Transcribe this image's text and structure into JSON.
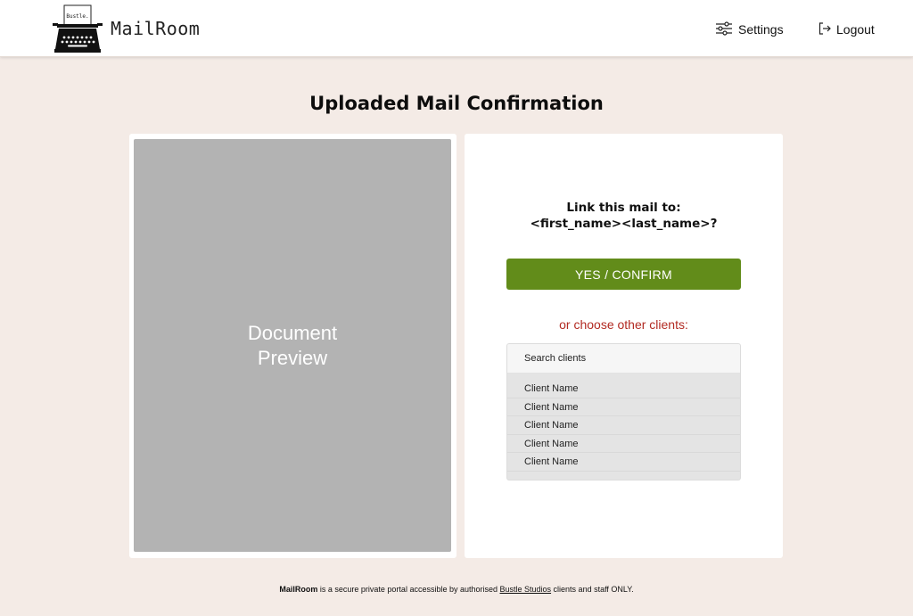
{
  "header": {
    "logo_text": "Bustle.",
    "brand": "MailRoom",
    "settings_label": "Settings",
    "logout_label": "Logout"
  },
  "page_title": "Uploaded Mail Confirmation",
  "preview": {
    "label_line1": "Document",
    "label_line2": "Preview"
  },
  "confirm": {
    "prompt_line1": "Link this mail to:",
    "prompt_line2": "<first_name><last_name>?",
    "button_label": "YES / CONFIRM",
    "choose_other": "or choose other clients:"
  },
  "clients": {
    "search_placeholder": "Search clients",
    "items": [
      "Client Name",
      "Client Name",
      "Client Name",
      "Client Name",
      "Client Name"
    ]
  },
  "footer": {
    "brand": "MailRoom",
    "text_before": " is a secure private portal accessible by authorised ",
    "link": "Bustle Studios",
    "text_after": " clients and staff ONLY."
  },
  "colors": {
    "background": "#f4ebe6",
    "confirm_button": "#628c1a",
    "choose_text": "#b22a22",
    "preview_gray": "#b3b3b3"
  }
}
